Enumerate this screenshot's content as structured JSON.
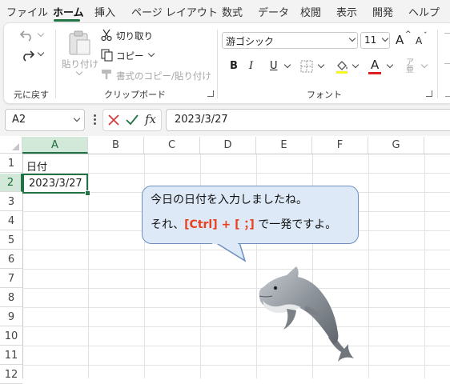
{
  "menu": {
    "tabs": [
      "ファイル",
      "ホーム",
      "挿入",
      "ページ レイアウト",
      "数式",
      "データ",
      "校閲",
      "表示",
      "開発",
      "ヘルプ"
    ],
    "active_tab": "ホーム"
  },
  "ribbon": {
    "undo_group": {
      "label": "元に戻す"
    },
    "clipboard": {
      "label": "クリップボード",
      "paste": "貼り付け",
      "cut": "切り取り",
      "copy": "コピー",
      "format_painter": "書式のコピー/貼り付け"
    },
    "font": {
      "label": "フォント",
      "font_name": "游ゴシック",
      "font_size": "11",
      "bold": "B",
      "italic": "I",
      "underline": "U",
      "font_color_letter": "A",
      "font_color": "#e02020",
      "grow": "A",
      "shrink": "A"
    }
  },
  "formula_bar": {
    "name_box": "A2",
    "fx_label": "fx",
    "value": "2023/3/27"
  },
  "grid": {
    "columns": [
      "A",
      "B",
      "C",
      "D",
      "E",
      "F",
      "G"
    ],
    "selected_column": "A",
    "rows": [
      "1",
      "2",
      "3",
      "4",
      "5",
      "6",
      "7",
      "8",
      "9",
      "10",
      "11",
      "12"
    ],
    "selected_row": "2",
    "cells": {
      "A1": "日付",
      "A2": "2023/3/27"
    }
  },
  "callout": {
    "line1": "今日の日付を入力しましたね。",
    "line2_prefix": "それ、",
    "line2_shortcut": "[Ctrl] + [ ；]",
    "line2_suffix": " で一発ですよ。"
  },
  "colors": {
    "accent": "#217346",
    "selection": "#d2e9da",
    "bubble": "#dde9f7",
    "shortcut": "#e8421f"
  }
}
